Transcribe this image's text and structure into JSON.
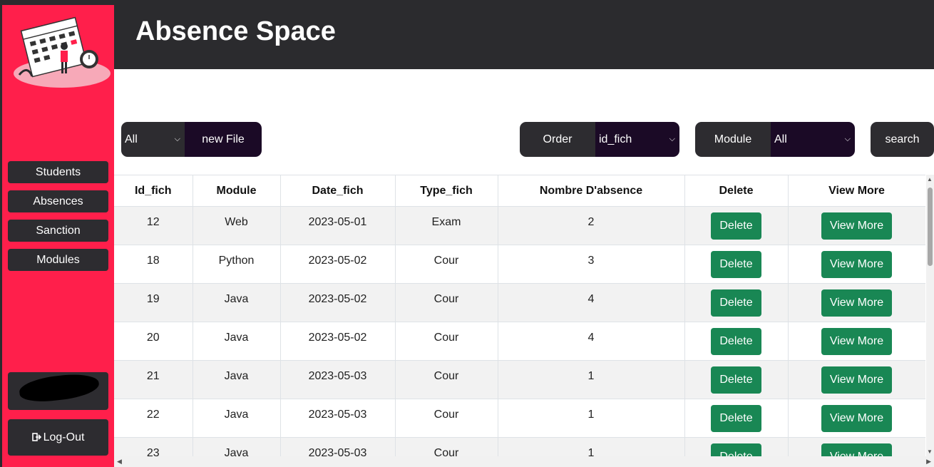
{
  "header": {
    "title": "Absence Space"
  },
  "sidebar": {
    "items": [
      {
        "label": "Students"
      },
      {
        "label": "Absences"
      },
      {
        "label": "Sanction"
      },
      {
        "label": "Modules"
      }
    ],
    "logout": {
      "label": "Log-Out",
      "icon": "logout-icon"
    }
  },
  "toolbar": {
    "filter_select_value": "All",
    "new_file_label": "new File",
    "order_label": "Order",
    "order_select_value": "id_fich",
    "module_label": "Module",
    "module_select_value": "All",
    "search_label": "search"
  },
  "table": {
    "headers": [
      "Id_fich",
      "Module",
      "Date_fich",
      "Type_fich",
      "Nombre D'absence",
      "Delete",
      "View More"
    ],
    "rows": [
      {
        "id": "12",
        "module": "Web",
        "date": "2023-05-01",
        "type": "Exam",
        "count": "2",
        "delete": "Delete",
        "view": "View More"
      },
      {
        "id": "18",
        "module": "Python",
        "date": "2023-05-02",
        "type": "Cour",
        "count": "3",
        "delete": "Delete",
        "view": "View More"
      },
      {
        "id": "19",
        "module": "Java",
        "date": "2023-05-02",
        "type": "Cour",
        "count": "4",
        "delete": "Delete",
        "view": "View More"
      },
      {
        "id": "20",
        "module": "Java",
        "date": "2023-05-02",
        "type": "Cour",
        "count": "4",
        "delete": "Delete",
        "view": "View More"
      },
      {
        "id": "21",
        "module": "Java",
        "date": "2023-05-03",
        "type": "Cour",
        "count": "1",
        "delete": "Delete",
        "view": "View More"
      },
      {
        "id": "22",
        "module": "Java",
        "date": "2023-05-03",
        "type": "Cour",
        "count": "1",
        "delete": "Delete",
        "view": "View More"
      },
      {
        "id": "23",
        "module": "Java",
        "date": "2023-05-03",
        "type": "Cour",
        "count": "1",
        "delete": "Delete",
        "view": "View More"
      }
    ]
  },
  "colors": {
    "sidebar": "#ff1f4b",
    "header": "#2b2b2e",
    "button_green": "#198754",
    "dark": "#2d2c30",
    "addon": "#1b0a26"
  }
}
